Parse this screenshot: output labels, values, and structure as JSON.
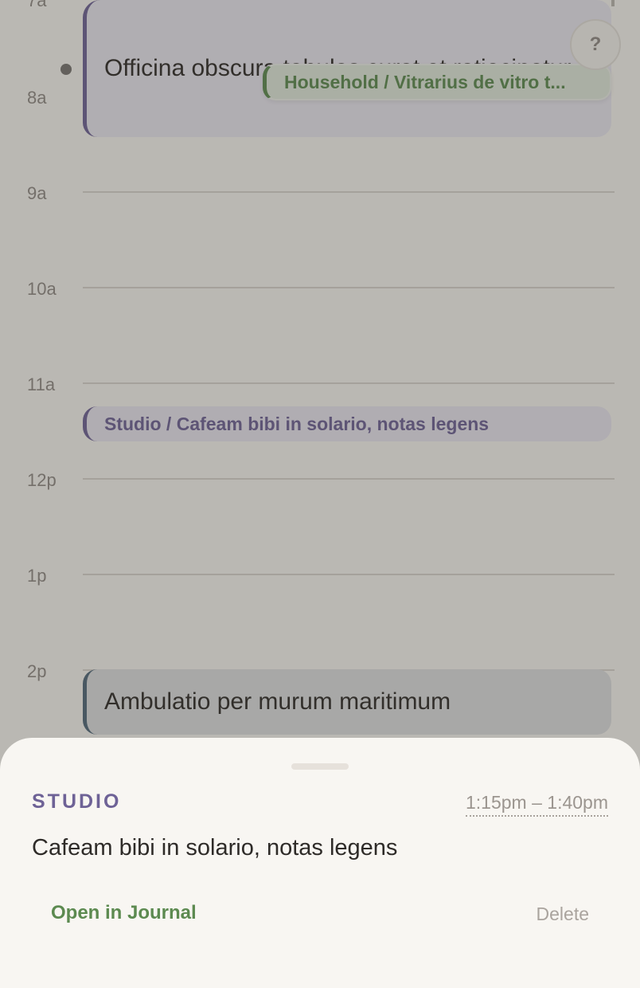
{
  "timeline": {
    "hours": [
      "7a",
      "8a",
      "9a",
      "10a",
      "11a",
      "12p",
      "1p",
      "2p"
    ]
  },
  "events": {
    "officina": {
      "title": "Officina obscura tabulas curat et ratiocinatur"
    },
    "household_chip": {
      "label": "Household / Vitrarius de vitro t..."
    },
    "studio": {
      "label": "Studio / Cafeam bibi in solario, notas legens"
    },
    "ambulatio": {
      "title": "Ambulatio per murum maritimum"
    }
  },
  "help": {
    "label": "?"
  },
  "sheet": {
    "category": "STUDIO",
    "time_range": "1:15pm – 1:40pm",
    "text": "Cafeam bibi in solario, notas legens",
    "open_label": "Open in Journal",
    "delete_label": "Delete"
  },
  "colors": {
    "studio_accent": "#6e6296",
    "household_accent": "#5c8a50",
    "ambulatio_accent": "#506779"
  }
}
